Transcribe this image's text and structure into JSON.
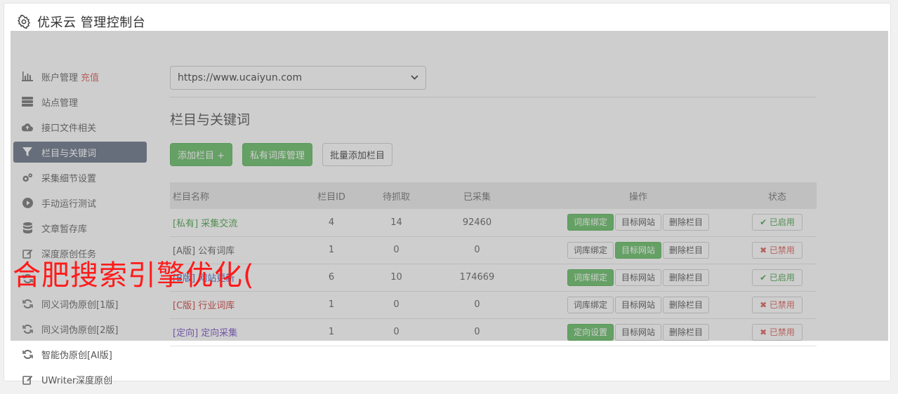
{
  "header": {
    "title": "优采云 管理控制台",
    "icon": "gear-icon"
  },
  "sidebar": {
    "items": [
      {
        "label": "账户管理",
        "extra": "充值",
        "icon": "bar-chart-icon"
      },
      {
        "label": "站点管理",
        "icon": "server-icon"
      },
      {
        "label": "接口文件相关",
        "icon": "cloud-upload-icon"
      },
      {
        "label": "栏目与关键词",
        "icon": "filter-icon",
        "active": true
      },
      {
        "label": "采集细节设置",
        "icon": "cogs-icon"
      },
      {
        "label": "手动运行测试",
        "icon": "play-circle-icon"
      },
      {
        "label": "文章暂存库",
        "icon": "database-icon"
      },
      {
        "label": "深度原创任务",
        "icon": "edit-icon"
      },
      {
        "label": "",
        "icon": "refresh-icon"
      },
      {
        "label": "同义词伪原创[1版]",
        "icon": "refresh-icon"
      },
      {
        "label": "同义词伪原创[2版]",
        "icon": "refresh-icon"
      },
      {
        "label": "智能伪原创[AI版]",
        "icon": "refresh-icon"
      },
      {
        "label": "UWriter深度原创",
        "icon": "edit-icon"
      }
    ]
  },
  "main": {
    "site_select": {
      "value": "https://www.ucaiyun.com"
    },
    "section_title": "栏目与关键词",
    "toolbar": {
      "add": "添加栏目 +",
      "private_lib": "私有词库管理",
      "batch_add": "批量添加栏目"
    },
    "table": {
      "headers": {
        "name": "栏目名称",
        "id": "栏目ID",
        "pending": "待抓取",
        "collected": "已采集",
        "ops": "操作",
        "status": "状态"
      },
      "rows": [
        {
          "tag": "[私有]",
          "name": "采集交流",
          "tag_class": "tag-private",
          "id": "4",
          "pending": "14",
          "collected": "92460",
          "op1": "词库绑定",
          "op1_green": true,
          "op2": "目标网站",
          "op2_green": false,
          "op3": "删除栏目",
          "status": "✔ 已启用",
          "status_on": true
        },
        {
          "tag": "[A版]",
          "name": "公有词库",
          "tag_class": "tag-a",
          "id": "1",
          "pending": "0",
          "collected": "0",
          "op1": "词库绑定",
          "op1_green": false,
          "op2": "目标网站",
          "op2_green": true,
          "op3": "删除栏目",
          "status": "✖ 已禁用",
          "status_on": false
        },
        {
          "tag": "[B版]",
          "name": "网站更新",
          "tag_class": "tag-b",
          "id": "6",
          "pending": "10",
          "collected": "174669",
          "op1": "词库绑定",
          "op1_green": true,
          "op2": "目标网站",
          "op2_green": false,
          "op3": "删除栏目",
          "status": "✔ 已启用",
          "status_on": true
        },
        {
          "tag": "[C版]",
          "name": "行业词库",
          "tag_class": "tag-c",
          "id": "1",
          "pending": "0",
          "collected": "0",
          "op1": "词库绑定",
          "op1_green": false,
          "op2": "目标网站",
          "op2_green": false,
          "op3": "删除栏目",
          "status": "✖ 已禁用",
          "status_on": false
        },
        {
          "tag": "[定向]",
          "name": "定向采集",
          "tag_class": "tag-dir",
          "id": "1",
          "pending": "0",
          "collected": "0",
          "op1": "定向设置",
          "op1_green": true,
          "op2": "目标网站",
          "op2_green": false,
          "op3": "删除栏目",
          "status": "✖ 已禁用",
          "status_on": false
        }
      ]
    }
  },
  "watermark": "合肥搜索引擎优化("
}
